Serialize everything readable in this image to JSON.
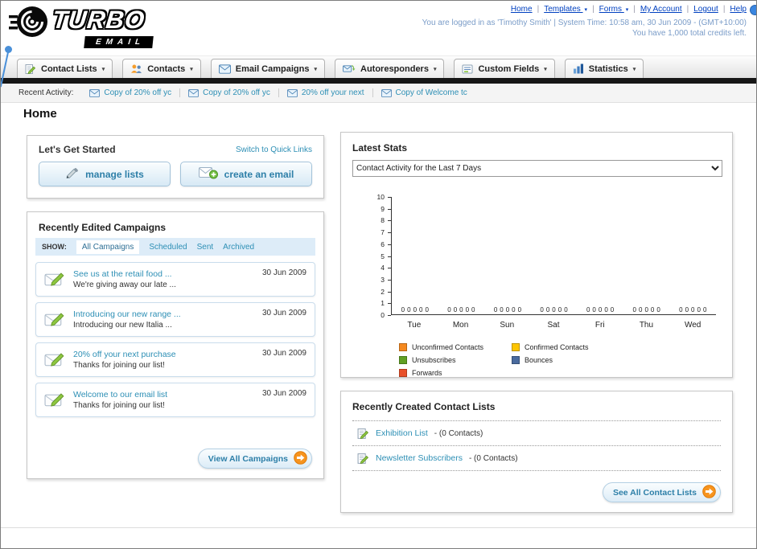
{
  "colors": {
    "accent_teal": "#2d8fb5",
    "link_blue": "#0040c0",
    "orange_arrow": "#f7941e",
    "black_bar": "#161616",
    "filter_bar_bg": "#ddecf8"
  },
  "header": {
    "logo": {
      "turbo": "TURBO",
      "email": "EMAIL"
    },
    "nav_links": [
      {
        "label": "Home",
        "caret": false
      },
      {
        "label": "Templates",
        "caret": true
      },
      {
        "label": "Forms",
        "caret": true
      },
      {
        "label": "My Account",
        "caret": false
      },
      {
        "label": "Logout",
        "caret": false
      },
      {
        "label": "Help",
        "caret": false
      }
    ],
    "login_line1": "You are logged in as 'Timothy Smith' | System Time: 10:58 am, 30 Jun 2009 - (GMT+10:00)",
    "login_line2": "You have 1,000 total credits left."
  },
  "main_nav": {
    "tabs": [
      {
        "label": "Contact Lists",
        "icon": "contact-lists-icon"
      },
      {
        "label": "Contacts",
        "icon": "contacts-icon"
      },
      {
        "label": "Email Campaigns",
        "icon": "email-campaigns-icon"
      },
      {
        "label": "Autoresponders",
        "icon": "autoresponders-icon"
      },
      {
        "label": "Custom Fields",
        "icon": "custom-fields-icon"
      },
      {
        "label": "Statistics",
        "icon": "statistics-icon"
      }
    ]
  },
  "recent_activity": {
    "label": "Recent Activity:",
    "items": [
      "Copy of 20% off yc",
      "Copy of 20% off yc",
      "20% off your next",
      "Copy of Welcome tc"
    ]
  },
  "page_title": "Home",
  "get_started": {
    "title": "Let's Get Started",
    "switch_link": "Switch to Quick Links",
    "manage_lists_label": "manage lists",
    "create_email_label": "create an email"
  },
  "campaigns": {
    "title": "Recently Edited Campaigns",
    "show_label": "SHOW:",
    "filters": [
      "All Campaigns",
      "Scheduled",
      "Sent",
      "Archived"
    ],
    "active_filter_index": 0,
    "items": [
      {
        "title": "See us at the retail food ...",
        "subtitle": "We're giving away our late ...",
        "date": "30 Jun 2009"
      },
      {
        "title": "Introducing our new range ...",
        "subtitle": "Introducing our new Italia ...",
        "date": "30 Jun 2009"
      },
      {
        "title": "20% off your next purchase",
        "subtitle": "Thanks for joining our list!",
        "date": "30 Jun 2009"
      },
      {
        "title": "Welcome to our email list",
        "subtitle": "Thanks for joining our list!",
        "date": "30 Jun 2009"
      }
    ],
    "view_all_label": "View All Campaigns"
  },
  "latest_stats": {
    "title": "Latest Stats",
    "dropdown_value": "Contact Activity for the Last 7 Days",
    "chart_data": {
      "type": "bar",
      "title": "Contact Activity for the Last 7 Days",
      "categories": [
        "Tue",
        "Mon",
        "Sun",
        "Sat",
        "Fri",
        "Thu",
        "Wed"
      ],
      "series": [
        {
          "name": "Unconfirmed Contacts",
          "color": "#f5891f",
          "values": [
            0,
            0,
            0,
            0,
            0,
            0,
            0
          ]
        },
        {
          "name": "Confirmed Contacts",
          "color": "#fdc500",
          "values": [
            0,
            0,
            0,
            0,
            0,
            0,
            0
          ]
        },
        {
          "name": "Unsubscribes",
          "color": "#61a024",
          "values": [
            0,
            0,
            0,
            0,
            0,
            0,
            0
          ]
        },
        {
          "name": "Bounces",
          "color": "#4a6b9e",
          "values": [
            0,
            0,
            0,
            0,
            0,
            0,
            0
          ]
        },
        {
          "name": "Forwards",
          "color": "#e8502a",
          "values": [
            0,
            0,
            0,
            0,
            0,
            0,
            0
          ]
        }
      ],
      "xlabel": "",
      "ylabel": "",
      "ylim": [
        0,
        10
      ],
      "yticks": [
        0,
        1,
        2,
        3,
        4,
        5,
        6,
        7,
        8,
        9,
        10
      ],
      "grid": false,
      "legend_position": "bottom",
      "value_labels": true
    }
  },
  "contact_lists": {
    "title": "Recently Created Contact Lists",
    "items": [
      {
        "name": "Exhibition List",
        "detail": "- (0 Contacts)"
      },
      {
        "name": "Newsletter Subscribers",
        "detail": "- (0 Contacts)"
      }
    ],
    "see_all_label": "See All Contact Lists"
  }
}
